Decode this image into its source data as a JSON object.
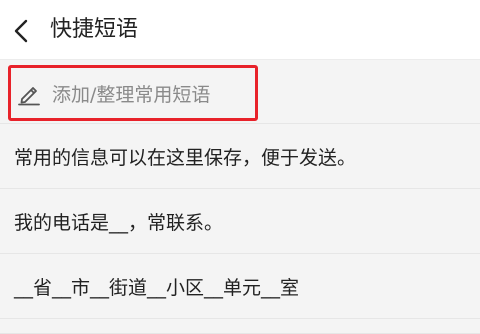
{
  "header": {
    "back_icon": "chevron-left-icon",
    "title": "快捷短语"
  },
  "add_action": {
    "icon": "pencil-icon",
    "label": "添加/整理常用短语",
    "highlight_color": "#e8222a"
  },
  "phrases": [
    {
      "text": "常用的信息可以在这里保存，便于发送。"
    },
    {
      "text": "我的电话是__，常联系。"
    },
    {
      "text": "__省__市__街道__小区__单元__室"
    }
  ]
}
